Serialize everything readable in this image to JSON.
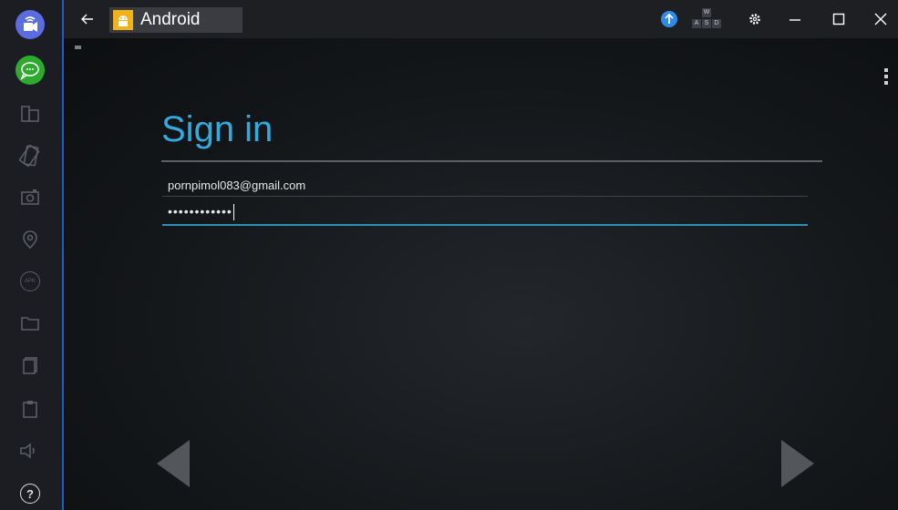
{
  "window": {
    "app_title": "Android",
    "keyboard_keys": [
      "W",
      "A",
      "S",
      "D"
    ]
  },
  "sidebar": {
    "items": [
      {
        "icon": "video-call-icon",
        "active": true
      },
      {
        "icon": "chat-icon",
        "active": true
      },
      {
        "icon": "multi-window-icon"
      },
      {
        "icon": "rotate-icon"
      },
      {
        "icon": "camera-icon"
      },
      {
        "icon": "location-icon"
      },
      {
        "icon": "apk-icon"
      },
      {
        "icon": "folder-icon"
      },
      {
        "icon": "copy-icon"
      },
      {
        "icon": "paste-icon"
      },
      {
        "icon": "volume-icon"
      },
      {
        "icon": "help-icon"
      }
    ],
    "apk_label": "APK",
    "help_label": "?"
  },
  "signin": {
    "heading": "Sign in",
    "email_value": "pornpimol083@gmail.com",
    "password_masked": "••••••••••••"
  },
  "colors": {
    "accent": "#34a9dc",
    "sidebar_bg": "#1b1d22",
    "topbar_bg": "#1e1f23",
    "chat_green": "#2eaa2e",
    "video_blue": "#5b6be0"
  }
}
